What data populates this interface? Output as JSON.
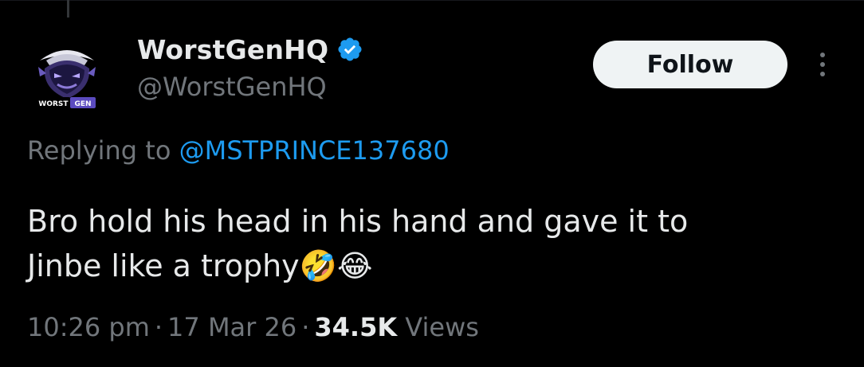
{
  "author": {
    "display_name": "WorstGenHQ",
    "handle": "@WorstGenHQ",
    "verified": true,
    "avatar_icon": "worstgen-logo-icon",
    "avatar_text": "WORST GEN"
  },
  "actions": {
    "follow_label": "Follow",
    "more_icon": "more-vertical-icon"
  },
  "reply": {
    "prefix": "Replying to ",
    "mention": "@MSTPRINCE137680"
  },
  "tweet": {
    "text": "Bro hold his head in his hand and gave it to\nJinbe like a trophy🤣😂"
  },
  "meta": {
    "time": "10:26 pm",
    "separator": "·",
    "date": "17 Mar 26",
    "views_count": "34.5K",
    "views_label": " Views"
  },
  "colors": {
    "background": "#000000",
    "text_primary": "#e7e9ea",
    "text_secondary": "#71767b",
    "accent": "#1d9bf0",
    "follow_bg": "#eff3f4"
  }
}
